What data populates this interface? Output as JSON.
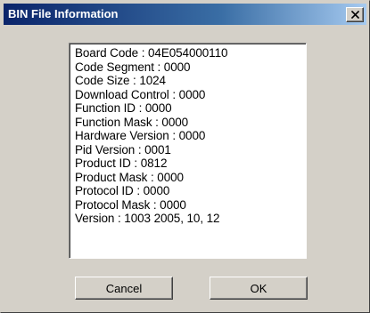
{
  "window": {
    "title": "BIN File Information",
    "close_icon": "close-icon"
  },
  "info_lines": [
    "Board Code : 04E054000110",
    "Code Segment : 0000",
    "Code Size : 1024",
    "Download Control : 0000",
    "Function ID : 0000",
    "Function Mask : 0000",
    "Hardware Version : 0000",
    "Pid Version : 0001",
    "Product ID : 0812",
    "Product Mask : 0000",
    "Protocol ID : 0000",
    "Protocol Mask : 0000",
    "Version : 1003  2005, 10, 12"
  ],
  "buttons": {
    "cancel_label": "Cancel",
    "ok_label": "OK"
  },
  "colors": {
    "title_start": "#0a246a",
    "title_end": "#a6caf0",
    "face": "#d4d0c8"
  }
}
